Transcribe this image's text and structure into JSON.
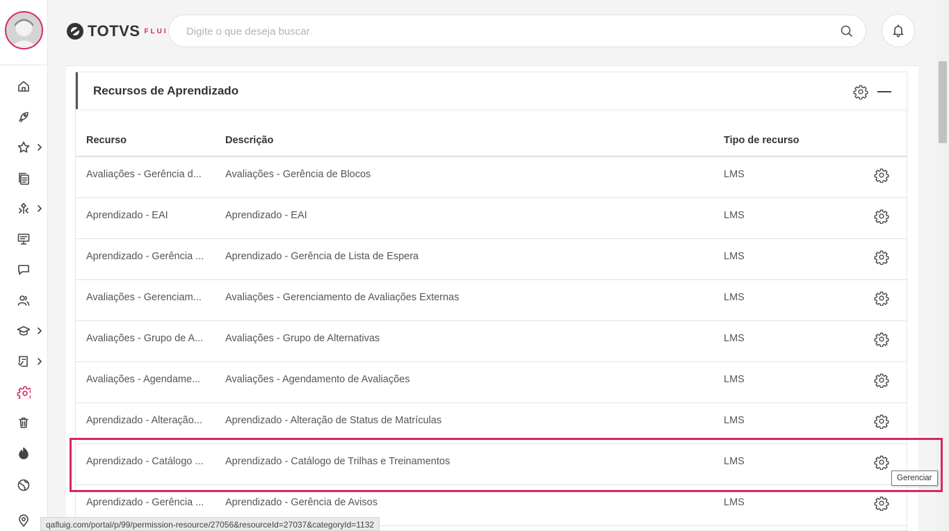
{
  "header": {
    "logo_text": "TOTVS",
    "logo_sub": "FLUIG",
    "search_placeholder": "Digite o que deseja buscar"
  },
  "sidebar": {
    "items": [
      {
        "icon": "home-icon",
        "has_submenu": false,
        "active": false
      },
      {
        "icon": "rocket-icon",
        "has_submenu": false,
        "active": false
      },
      {
        "icon": "star-icon",
        "has_submenu": true,
        "active": false
      },
      {
        "icon": "documents-icon",
        "has_submenu": false,
        "active": false
      },
      {
        "icon": "workflow-icon",
        "has_submenu": true,
        "active": false
      },
      {
        "icon": "presentation-icon",
        "has_submenu": false,
        "active": false
      },
      {
        "icon": "chat-icon",
        "has_submenu": false,
        "active": false
      },
      {
        "icon": "users-icon",
        "has_submenu": false,
        "active": false
      },
      {
        "icon": "graduation-cap-icon",
        "has_submenu": true,
        "active": false
      },
      {
        "icon": "checklist-icon",
        "has_submenu": true,
        "active": false
      },
      {
        "icon": "gear-icon",
        "has_submenu": false,
        "active": true
      },
      {
        "icon": "trash-icon",
        "has_submenu": false,
        "active": false
      },
      {
        "icon": "flame-icon",
        "has_submenu": false,
        "active": false
      },
      {
        "icon": "globe-icon",
        "has_submenu": false,
        "active": false
      },
      {
        "icon": "location-icon",
        "has_submenu": false,
        "active": false
      }
    ]
  },
  "panel": {
    "title": "Recursos de Aprendizado",
    "columns": [
      "Recurso",
      "Descrição",
      "Tipo de recurso"
    ],
    "rows": [
      {
        "recurso": "Avaliações - Gerência d...",
        "descricao": "Avaliações - Gerência de Blocos",
        "tipo": "LMS"
      },
      {
        "recurso": "Aprendizado - EAI",
        "descricao": "Aprendizado - EAI",
        "tipo": "LMS"
      },
      {
        "recurso": "Aprendizado - Gerência ...",
        "descricao": "Aprendizado - Gerência de Lista de Espera",
        "tipo": "LMS"
      },
      {
        "recurso": "Avaliações - Gerenciam...",
        "descricao": "Avaliações - Gerenciamento de Avaliações Externas",
        "tipo": "LMS"
      },
      {
        "recurso": "Avaliações - Grupo de A...",
        "descricao": "Avaliações - Grupo de Alternativas",
        "tipo": "LMS"
      },
      {
        "recurso": "Avaliações - Agendame...",
        "descricao": "Avaliações - Agendamento de Avaliações",
        "tipo": "LMS"
      },
      {
        "recurso": "Aprendizado - Alteração...",
        "descricao": "Aprendizado - Alteração de Status de Matrículas",
        "tipo": "LMS"
      },
      {
        "recurso": "Aprendizado - Catálogo ...",
        "descricao": "Aprendizado - Catálogo de Trilhas e Treinamentos",
        "tipo": "LMS"
      },
      {
        "recurso": "Aprendizado - Gerência ...",
        "descricao": "Aprendizado - Gerência de Avisos",
        "tipo": "LMS"
      }
    ]
  },
  "tooltip": "Gerenciar",
  "status_url": "qafluig.com/portal/p/99/permission-resource/27056&resourceId=27037&categoryId=1132",
  "colors": {
    "accent": "#d6266a"
  }
}
